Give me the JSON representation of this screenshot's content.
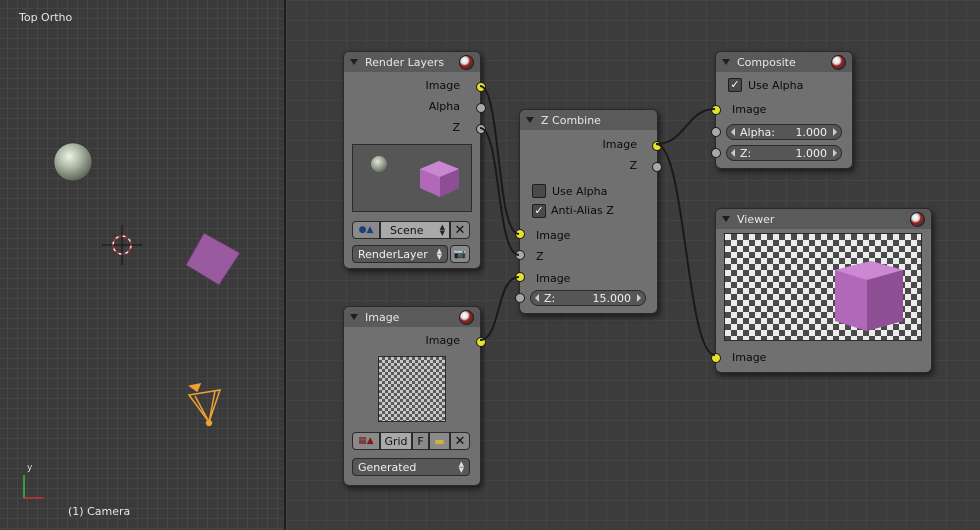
{
  "viewport": {
    "title": "Top Ortho",
    "status": "(1) Camera",
    "axis_y": "y",
    "colors": {
      "background": "#3a3a3a",
      "sphere": "#b8c2b0",
      "cube": "#9a5aa0",
      "camera": "#f0a030",
      "cursor": "#d02020"
    }
  },
  "nodes": {
    "render_layers": {
      "title": "Render Layers",
      "outputs": [
        "Image",
        "Alpha",
        "Z"
      ],
      "scene_label": "Scene",
      "layer_label": "RenderLayer"
    },
    "image": {
      "title": "Image",
      "output": "Image",
      "image_name": "Grid",
      "fake_user": "F",
      "source": "Generated"
    },
    "z_combine": {
      "title": "Z Combine",
      "outputs": [
        "Image",
        "Z"
      ],
      "use_alpha_label": "Use Alpha",
      "use_alpha": false,
      "antialias_label": "Anti-Alias Z",
      "antialias": true,
      "inputs": [
        "Image",
        "Z",
        "Image"
      ],
      "z_label": "Z:",
      "z_value": "15.000"
    },
    "composite": {
      "title": "Composite",
      "use_alpha_label": "Use Alpha",
      "use_alpha": true,
      "input": "Image",
      "alpha_label": "Alpha:",
      "alpha_value": "1.000",
      "z_label": "Z:",
      "z_value": "1.000"
    },
    "viewer": {
      "title": "Viewer",
      "input": "Image"
    }
  },
  "colors": {
    "socket_color": "#e4e22c",
    "socket_value": "#a8a8a8",
    "node_body": "#707070",
    "node_header": "#5a5a5a",
    "wire": "#1a1a1a"
  }
}
